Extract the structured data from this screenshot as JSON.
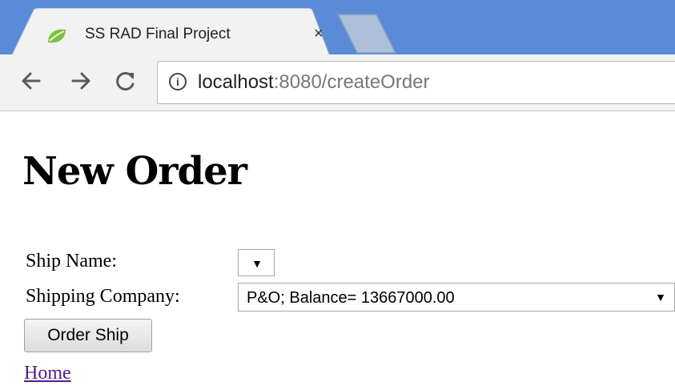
{
  "browser": {
    "tab_title": "SS RAD Final Project",
    "tab_close": "×",
    "url_host": "localhost",
    "url_rest": ":8080/createOrder",
    "info_icon_glyph": "i"
  },
  "page": {
    "title": "New Order",
    "ship_name_label": "Ship Name:",
    "ship_name_value": "",
    "shipping_company_label": "Shipping Company:",
    "shipping_company_value": "P&O; Balance= 13667000.00",
    "dropdown_arrow": "▼",
    "order_button": "Order Ship",
    "home_link": "Home"
  },
  "colors": {
    "tabstrip": "#5b8bd6",
    "link_visited": "#551a8b"
  }
}
